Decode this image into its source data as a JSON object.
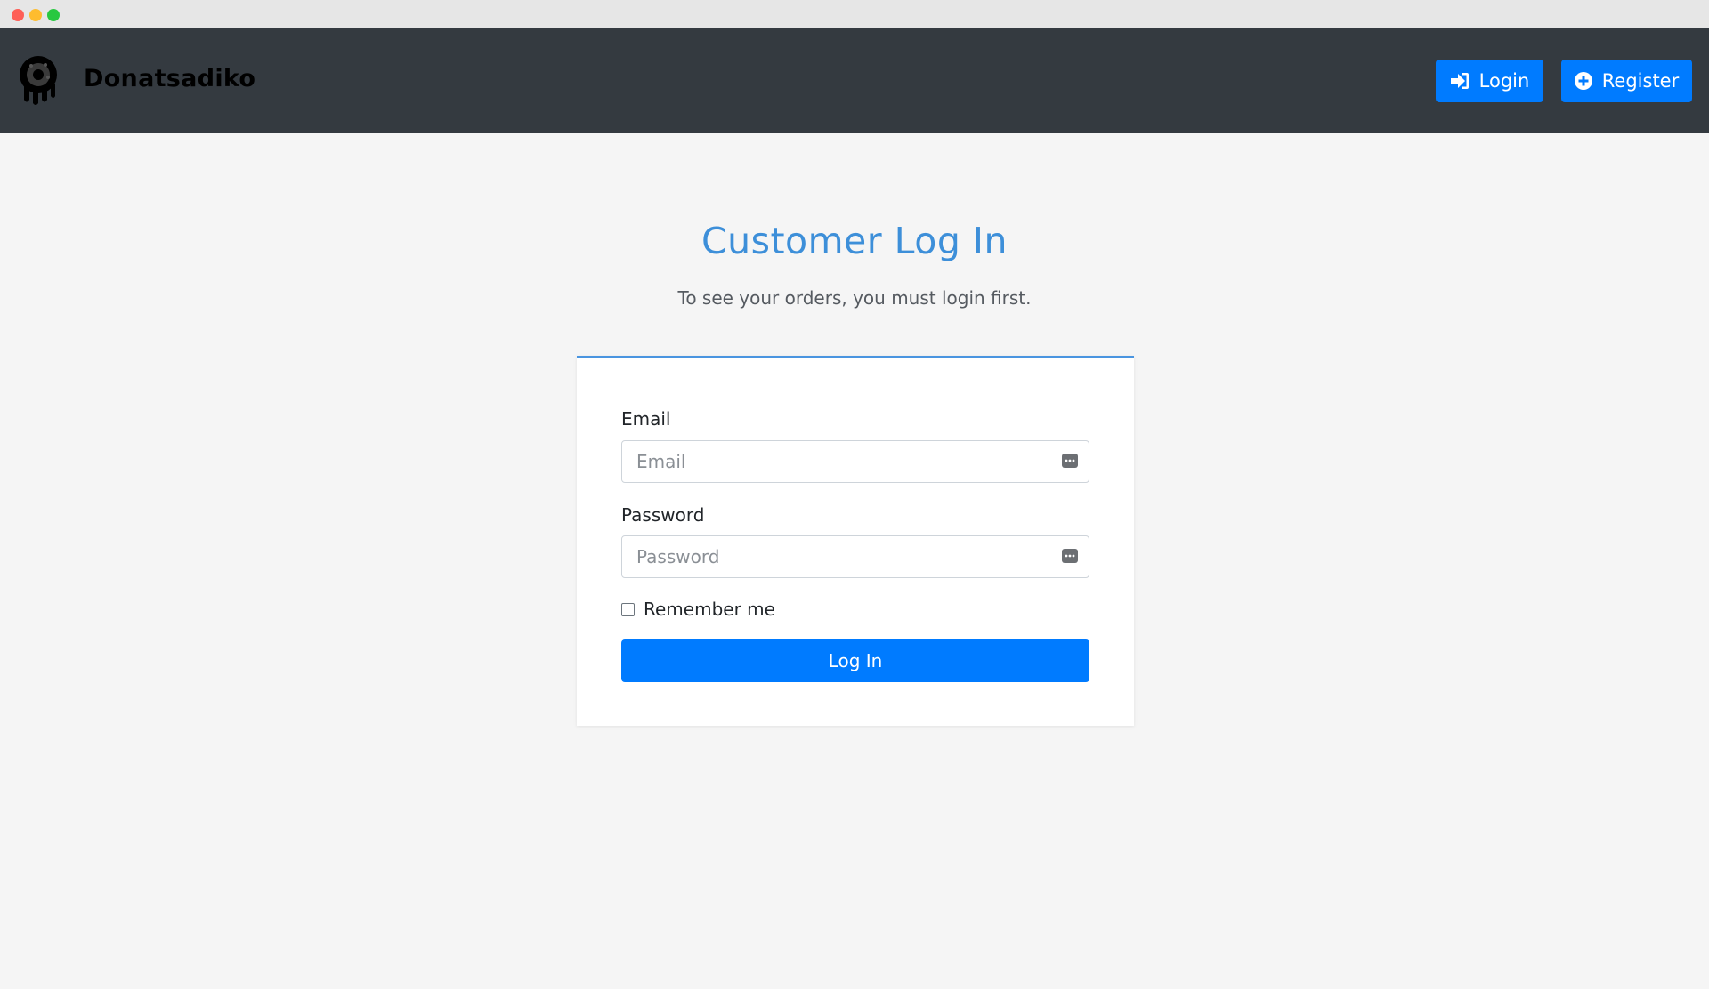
{
  "window": {
    "controls": [
      "close",
      "minimize",
      "zoom"
    ]
  },
  "navbar": {
    "brand_name": "Donatsadiko",
    "logo_icon": "donut-logo-icon",
    "login_label": "Login",
    "login_icon": "sign-in-icon",
    "register_label": "Register",
    "register_icon": "plus-circle-icon"
  },
  "page": {
    "title": "Customer Log In",
    "subtitle": "To see your orders, you must login first."
  },
  "form": {
    "email_label": "Email",
    "email_placeholder": "Email",
    "email_value": "",
    "password_label": "Password",
    "password_placeholder": "Password",
    "password_value": "",
    "field_icon": "password-manager-key-icon",
    "remember_label": "Remember me",
    "remember_checked": false,
    "submit_label": "Log In"
  },
  "colors": {
    "navbar_bg": "#343a40",
    "primary": "#007bff",
    "title": "#3d8fd9",
    "page_bg": "#f5f5f5"
  }
}
